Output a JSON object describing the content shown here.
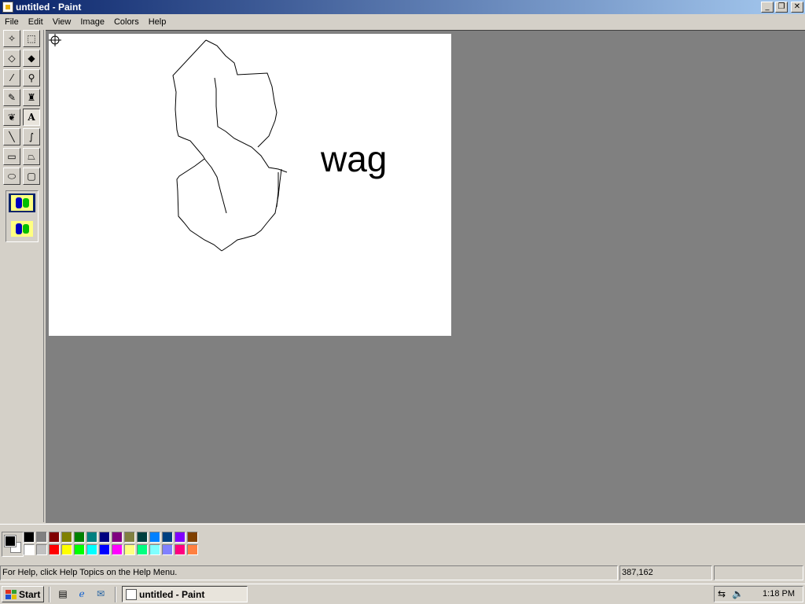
{
  "window": {
    "title": "untitled - Paint",
    "controls": [
      "minimize",
      "restore",
      "close"
    ]
  },
  "menu": [
    "File",
    "Edit",
    "View",
    "Image",
    "Colors",
    "Help"
  ],
  "toolbox": {
    "tools": [
      {
        "name": "free-form-select",
        "glyph": "✧"
      },
      {
        "name": "select",
        "glyph": "⬚"
      },
      {
        "name": "eraser",
        "glyph": "◇"
      },
      {
        "name": "fill-with-color",
        "glyph": "◆"
      },
      {
        "name": "pick-color",
        "glyph": "⁄"
      },
      {
        "name": "magnifier",
        "glyph": "⚲"
      },
      {
        "name": "pencil",
        "glyph": "✎"
      },
      {
        "name": "brush",
        "glyph": "♜"
      },
      {
        "name": "airbrush",
        "glyph": "❦"
      },
      {
        "name": "text",
        "glyph": "A"
      },
      {
        "name": "line",
        "glyph": "╲"
      },
      {
        "name": "curve",
        "glyph": "∫"
      },
      {
        "name": "rectangle",
        "glyph": "▭"
      },
      {
        "name": "polygon",
        "glyph": "⏢"
      },
      {
        "name": "ellipse",
        "glyph": "⬭"
      },
      {
        "name": "rounded-rectangle",
        "glyph": "▢"
      }
    ],
    "active_tool": "text",
    "options": [
      {
        "name": "opaque-background",
        "selected": true
      },
      {
        "name": "transparent-background",
        "selected": false
      }
    ]
  },
  "canvas": {
    "text": "wag"
  },
  "colors": {
    "foreground": "#000000",
    "background": "#ffffff",
    "palette_top": [
      "#000000",
      "#808080",
      "#800000",
      "#808000",
      "#008000",
      "#008080",
      "#000080",
      "#800080",
      "#808040",
      "#004040",
      "#0080ff",
      "#004080",
      "#8000ff",
      "#804000"
    ],
    "palette_bottom": [
      "#ffffff",
      "#c0c0c0",
      "#ff0000",
      "#ffff00",
      "#00ff00",
      "#00ffff",
      "#0000ff",
      "#ff00ff",
      "#ffff80",
      "#00ff80",
      "#80ffff",
      "#8080ff",
      "#ff0080",
      "#ff8040"
    ]
  },
  "status": {
    "help": "For Help, click Help Topics on the Help Menu.",
    "coords": "387,162",
    "size": ""
  },
  "taskbar": {
    "start_label": "Start",
    "quick_launch": [
      "show-desktop",
      "internet-explorer",
      "outlook-express"
    ],
    "task_label": "untitled - Paint",
    "clock": "1:18 PM"
  }
}
